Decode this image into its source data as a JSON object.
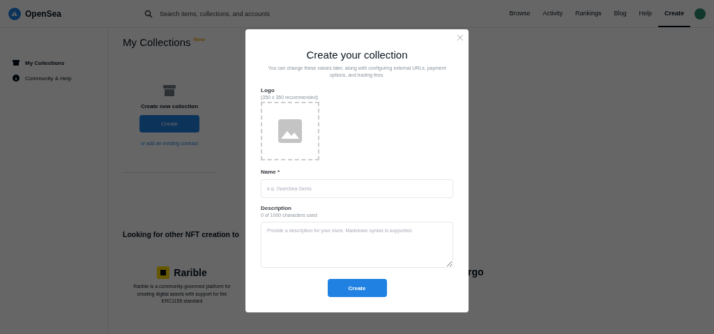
{
  "header": {
    "brand": "OpenSea",
    "search": {
      "placeholder": "Search items, collections, and accounts"
    },
    "nav": [
      {
        "label": "Browse",
        "selected": false
      },
      {
        "label": "Activity",
        "selected": false
      },
      {
        "label": "Rankings",
        "selected": false
      },
      {
        "label": "Blog",
        "selected": false
      },
      {
        "label": "Help",
        "selected": false
      },
      {
        "label": "Create",
        "selected": true
      }
    ]
  },
  "sidebar": {
    "items": [
      {
        "label": "My Collections",
        "selected": true
      },
      {
        "label": "Community & Help",
        "selected": false
      }
    ]
  },
  "main": {
    "title": "My Collections",
    "badge": "New",
    "create_card": {
      "title": "Create new collection",
      "button": "Create",
      "link": "or add an existing contract"
    },
    "tools_heading": "Looking for other NFT creation to",
    "tools": [
      {
        "name": "Rarible",
        "description": "Rarible is a community-governed platform for creating digital assets with support for the ERC1155 standard"
      },
      {
        "name": "rgo"
      }
    ]
  },
  "modal": {
    "title": "Create your collection",
    "subtitle": "You can change these values later, along with configuring external URLs, payment options, and trading fees.",
    "logo": {
      "label": "Logo",
      "hint": "(350 x 350 recommended)"
    },
    "name_field": {
      "label": "Name *",
      "placeholder": "e.g. OpenSea Gems"
    },
    "description_field": {
      "label": "Description",
      "counter": "0 of 1000 characters used",
      "placeholder": "Provide a description for your store. Markdown syntax is supported."
    },
    "button": "Create"
  }
}
